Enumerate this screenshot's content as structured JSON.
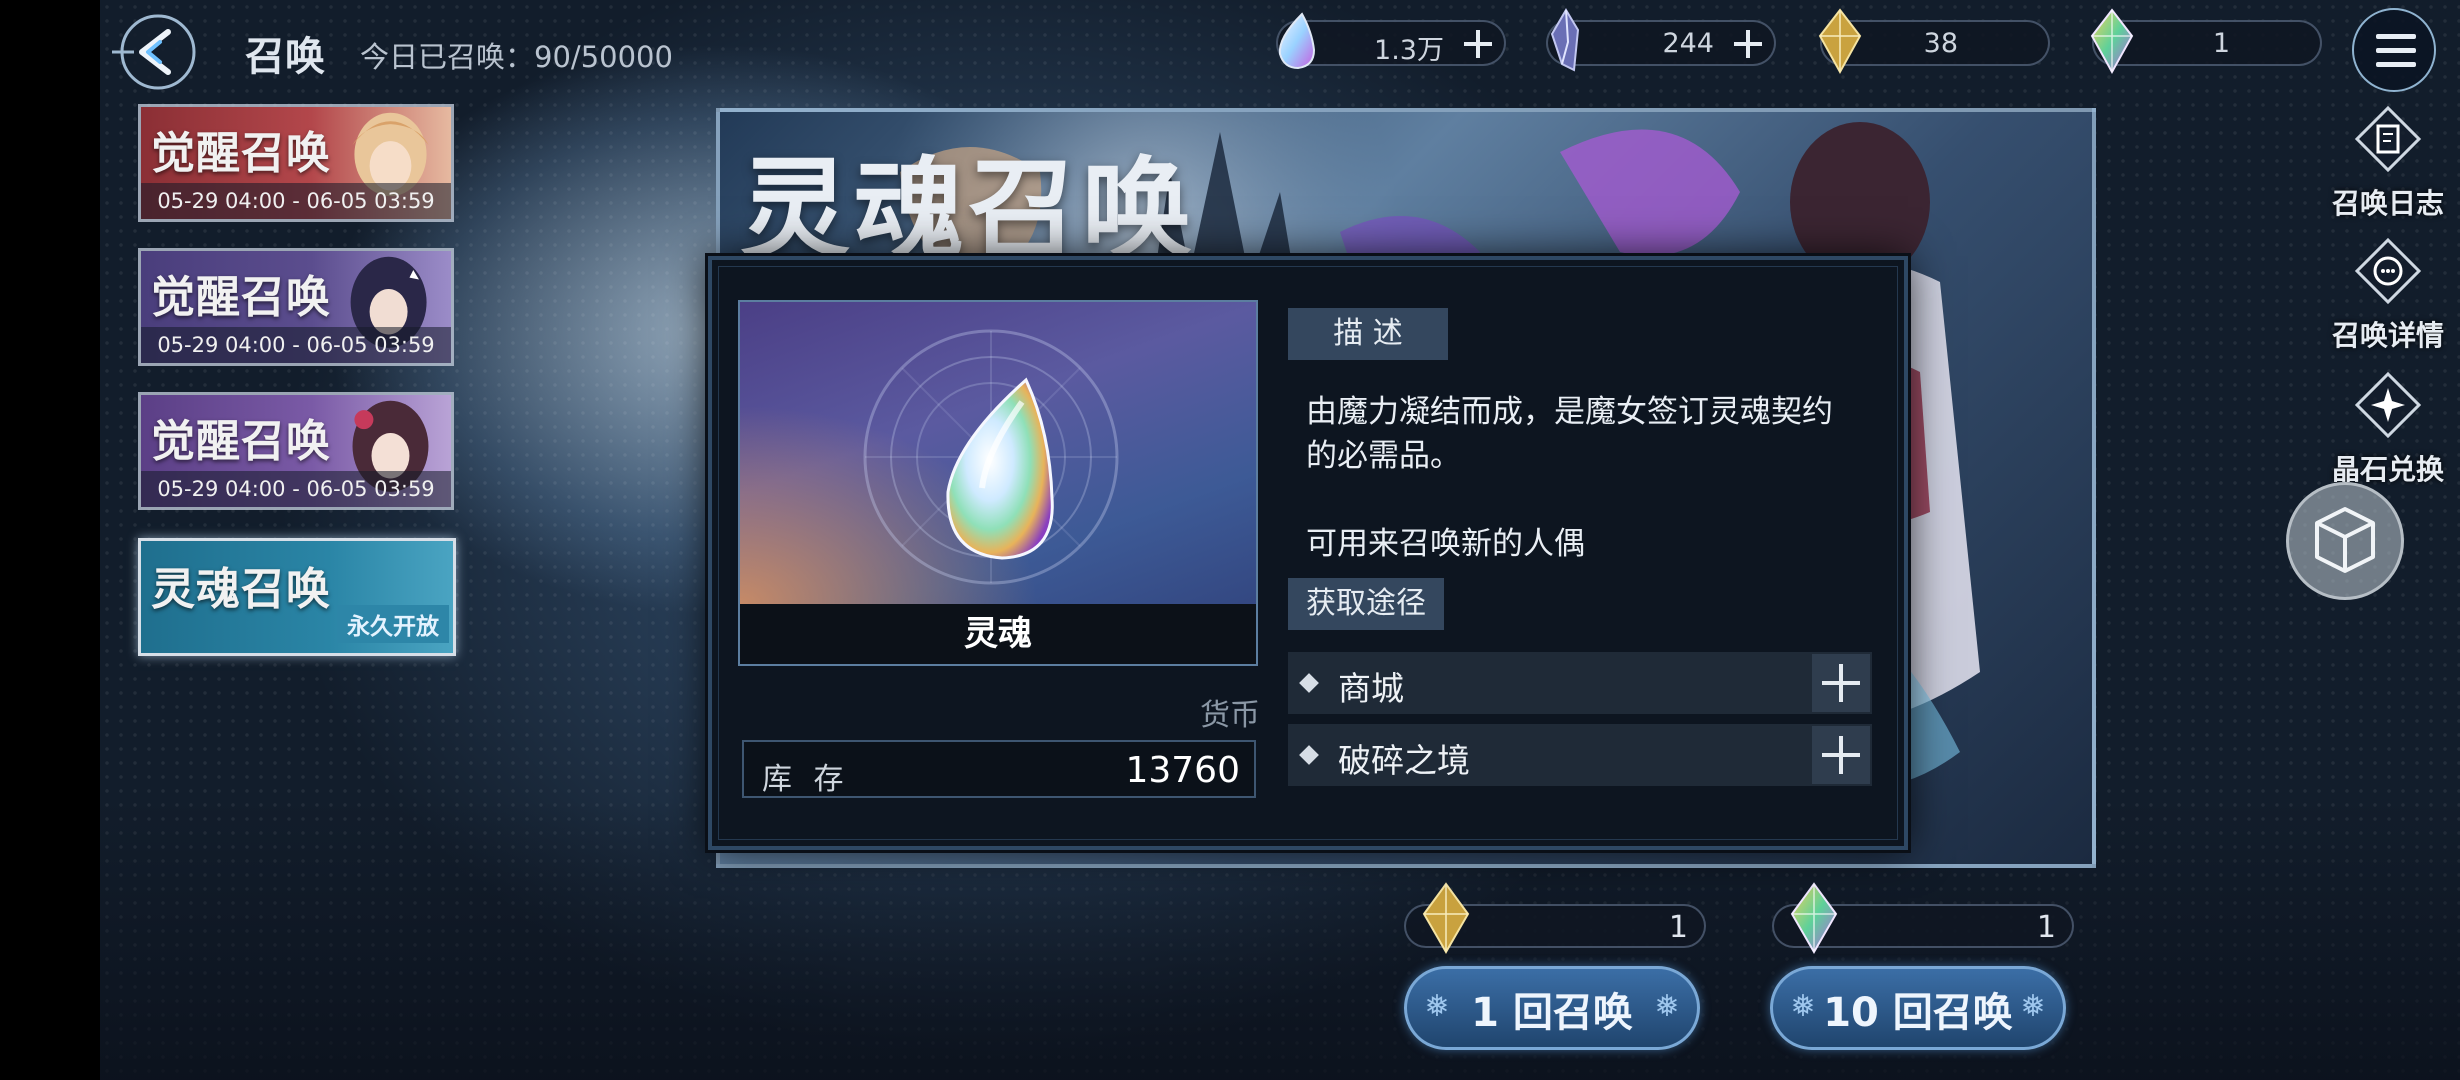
{
  "header": {
    "title": "召唤",
    "summon_count_label": "今日已召唤：",
    "summon_count_value": "90/50000"
  },
  "resources": [
    {
      "name": "soul-icon",
      "value": "1.3万",
      "has_plus": true
    },
    {
      "name": "crystal-icon",
      "value": "244",
      "has_plus": true
    },
    {
      "name": "gold-gem-icon",
      "value": "38",
      "has_plus": false
    },
    {
      "name": "rainbow-gem-icon",
      "value": "1",
      "has_plus": false
    }
  ],
  "banners": [
    {
      "name": "觉醒召唤",
      "date": "05-29 04:00 - 06-05 03:59",
      "theme": "red"
    },
    {
      "name": "觉醒召唤",
      "date": "05-29 04:00 - 06-05 03:59",
      "theme": "purple"
    },
    {
      "name": "觉醒召唤",
      "date": "05-29 04:00 - 06-05 03:59",
      "theme": "violet"
    },
    {
      "name": "灵魂召唤",
      "badge": "永久开放",
      "theme": "teal",
      "selected": true
    }
  ],
  "art_title": "灵魂召唤",
  "side_menu": {
    "log": "召唤日志",
    "details": "召唤详情",
    "exchange": "晶石兑换"
  },
  "item_popup": {
    "item_name": "灵魂",
    "category": "货币",
    "stock_label": "库 存",
    "stock_value": "13760",
    "desc_header": "描 述",
    "description_line1": "由魔力凝结而成，是魔女签订灵魂契约",
    "description_line2": "的必需品。",
    "description_line3": "可用来召唤新的人偶",
    "source_header": "获取途径",
    "sources": [
      "商城",
      "破碎之境"
    ]
  },
  "summon_costs": [
    {
      "icon": "gold-gem-icon",
      "value": "1"
    },
    {
      "icon": "rainbow-gem-icon",
      "value": "1"
    }
  ],
  "summon_buttons": {
    "single": "1 回召唤",
    "ten": "10 回召唤"
  },
  "colors": {
    "accent": "#2d86a8",
    "panel": "#0d1520",
    "button": "#3b6ea6"
  }
}
